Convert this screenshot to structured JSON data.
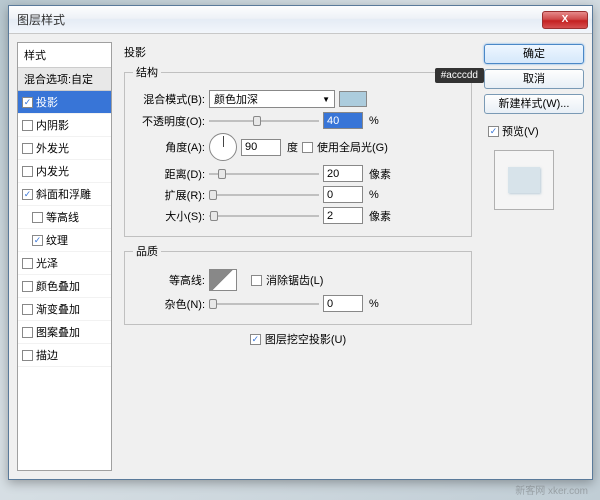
{
  "window": {
    "title": "图层样式"
  },
  "styles": {
    "header": "样式",
    "blend_header": "混合选项:自定",
    "items": [
      {
        "label": "投影",
        "checked": true,
        "selected": true,
        "indent": false
      },
      {
        "label": "内阴影",
        "checked": false,
        "indent": false
      },
      {
        "label": "外发光",
        "checked": false,
        "indent": false
      },
      {
        "label": "内发光",
        "checked": false,
        "indent": false
      },
      {
        "label": "斜面和浮雕",
        "checked": true,
        "indent": false
      },
      {
        "label": "等高线",
        "checked": false,
        "indent": true
      },
      {
        "label": "纹理",
        "checked": true,
        "indent": true
      },
      {
        "label": "光泽",
        "checked": false,
        "indent": false
      },
      {
        "label": "颜色叠加",
        "checked": false,
        "indent": false
      },
      {
        "label": "渐变叠加",
        "checked": false,
        "indent": false
      },
      {
        "label": "图案叠加",
        "checked": false,
        "indent": false
      },
      {
        "label": "描边",
        "checked": false,
        "indent": false
      }
    ]
  },
  "panel": {
    "title": "投影",
    "structure_legend": "结构",
    "quality_legend": "品质",
    "blend_mode_label": "混合模式(B):",
    "blend_mode_value": "颜色加深",
    "swatch_color": "#acccdd",
    "opacity_label": "不透明度(O):",
    "opacity_value": "40",
    "opacity_unit": "%",
    "angle_label": "角度(A):",
    "angle_value": "90",
    "angle_unit": "度",
    "global_light_label": "使用全局光(G)",
    "global_light_checked": false,
    "distance_label": "距离(D):",
    "distance_value": "20",
    "distance_unit": "像素",
    "spread_label": "扩展(R):",
    "spread_value": "0",
    "spread_unit": "%",
    "size_label": "大小(S):",
    "size_value": "2",
    "size_unit": "像素",
    "contour_label": "等高线:",
    "antialias_label": "消除锯齿(L)",
    "antialias_checked": false,
    "noise_label": "杂色(N):",
    "noise_value": "0",
    "noise_unit": "%",
    "knockout_label": "图层挖空投影(U)",
    "knockout_checked": true
  },
  "buttons": {
    "ok": "确定",
    "cancel": "取消",
    "new_style": "新建样式(W)...",
    "preview": "预览(V)",
    "preview_checked": true
  },
  "tooltip": "#acccdd",
  "watermark": "新客网 xker.com"
}
